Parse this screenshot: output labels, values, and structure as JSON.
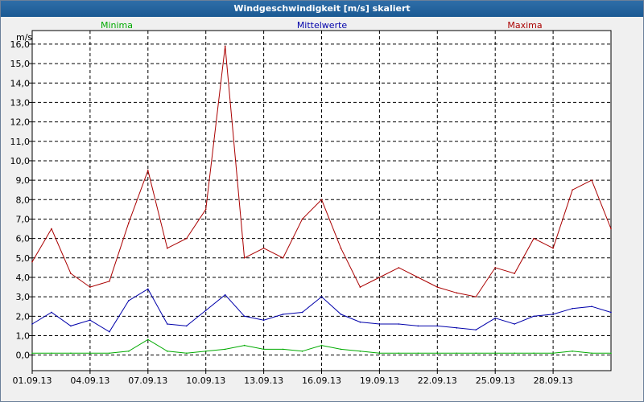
{
  "window": {
    "title": "Windgeschwindigkeit [m/s] skaliert"
  },
  "legend": {
    "min_label": "Minima",
    "mean_label": "Mittelwerte",
    "max_label": "Maxima"
  },
  "colors": {
    "min": "#00aa00",
    "mean": "#0000aa",
    "max": "#aa0000",
    "grid": "#000000",
    "plot_bg": "#ffffff"
  },
  "chart_data": {
    "type": "line",
    "title": "Windgeschwindigkeit [m/s] skaliert",
    "ylabel": "m/s",
    "xlabel": "",
    "ylim": [
      -0.8,
      16.7
    ],
    "xlim": [
      "2013-09-01",
      "2013-10-01"
    ],
    "y_ticks": [
      0,
      1,
      2,
      3,
      4,
      5,
      6,
      7,
      8,
      9,
      10,
      11,
      12,
      13,
      14,
      15,
      16
    ],
    "y_tick_labels": [
      "0,0",
      "1,0",
      "2,0",
      "3,0",
      "4,0",
      "5,0",
      "6,0",
      "7,0",
      "8,0",
      "9,0",
      "10,0",
      "11,0",
      "12,0",
      "13,0",
      "14,0",
      "15,0",
      "16,0"
    ],
    "x_tick_labels": [
      "01.09.13",
      "04.09.13",
      "07.09.13",
      "10.09.13",
      "13.09.13",
      "16.09.13",
      "19.09.13",
      "22.09.13",
      "25.09.13",
      "28.09.13"
    ],
    "x_ticks": [
      "2013-09-01",
      "2013-09-04",
      "2013-09-07",
      "2013-09-10",
      "2013-09-13",
      "2013-09-16",
      "2013-09-19",
      "2013-09-22",
      "2013-09-25",
      "2013-09-28"
    ],
    "grid": true,
    "legend_position": "top",
    "series": [
      {
        "name": "Minima",
        "x": [
          "2013-09-01",
          "2013-09-02",
          "2013-09-03",
          "2013-09-04",
          "2013-09-05",
          "2013-09-06",
          "2013-09-07",
          "2013-09-08",
          "2013-09-09",
          "2013-09-10",
          "2013-09-11",
          "2013-09-12",
          "2013-09-13",
          "2013-09-14",
          "2013-09-15",
          "2013-09-16",
          "2013-09-17",
          "2013-09-18",
          "2013-09-19",
          "2013-09-20",
          "2013-09-21",
          "2013-09-22",
          "2013-09-23",
          "2013-09-24",
          "2013-09-25",
          "2013-09-26",
          "2013-09-27",
          "2013-09-28",
          "2013-09-29",
          "2013-09-30",
          "2013-10-01"
        ],
        "values": [
          0.1,
          0.1,
          0.1,
          0.1,
          0.1,
          0.2,
          0.8,
          0.2,
          0.1,
          0.2,
          0.3,
          0.5,
          0.3,
          0.3,
          0.2,
          0.5,
          0.3,
          0.2,
          0.1,
          0.1,
          0.1,
          0.1,
          0.1,
          0.1,
          0.1,
          0.1,
          0.1,
          0.1,
          0.2,
          0.1,
          0.1
        ]
      },
      {
        "name": "Mittelwerte",
        "x": [
          "2013-09-01",
          "2013-09-02",
          "2013-09-03",
          "2013-09-04",
          "2013-09-05",
          "2013-09-06",
          "2013-09-07",
          "2013-09-08",
          "2013-09-09",
          "2013-09-10",
          "2013-09-11",
          "2013-09-12",
          "2013-09-13",
          "2013-09-14",
          "2013-09-15",
          "2013-09-16",
          "2013-09-17",
          "2013-09-18",
          "2013-09-19",
          "2013-09-20",
          "2013-09-21",
          "2013-09-22",
          "2013-09-23",
          "2013-09-24",
          "2013-09-25",
          "2013-09-26",
          "2013-09-27",
          "2013-09-28",
          "2013-09-29",
          "2013-09-30",
          "2013-10-01"
        ],
        "values": [
          1.6,
          2.2,
          1.5,
          1.8,
          1.2,
          2.8,
          3.4,
          1.6,
          1.5,
          2.3,
          3.1,
          2.0,
          1.8,
          2.1,
          2.2,
          3.0,
          2.1,
          1.7,
          1.6,
          1.6,
          1.5,
          1.5,
          1.4,
          1.3,
          1.9,
          1.6,
          2.0,
          2.1,
          2.4,
          2.5,
          2.2
        ]
      },
      {
        "name": "Maxima",
        "x": [
          "2013-09-01",
          "2013-09-02",
          "2013-09-03",
          "2013-09-04",
          "2013-09-05",
          "2013-09-06",
          "2013-09-07",
          "2013-09-08",
          "2013-09-09",
          "2013-09-10",
          "2013-09-11",
          "2013-09-12",
          "2013-09-13",
          "2013-09-14",
          "2013-09-15",
          "2013-09-16",
          "2013-09-17",
          "2013-09-18",
          "2013-09-19",
          "2013-09-20",
          "2013-09-21",
          "2013-09-22",
          "2013-09-23",
          "2013-09-24",
          "2013-09-25",
          "2013-09-26",
          "2013-09-27",
          "2013-09-28",
          "2013-09-29",
          "2013-09-30",
          "2013-10-01"
        ],
        "values": [
          4.8,
          6.5,
          4.2,
          3.5,
          3.8,
          6.8,
          9.5,
          5.5,
          6.0,
          7.5,
          15.9,
          5.0,
          5.5,
          5.0,
          7.0,
          8.0,
          5.5,
          3.5,
          4.0,
          4.5,
          4.0,
          3.5,
          3.2,
          3.0,
          4.5,
          4.2,
          6.0,
          5.5,
          8.5,
          9.0,
          6.5
        ]
      }
    ]
  }
}
